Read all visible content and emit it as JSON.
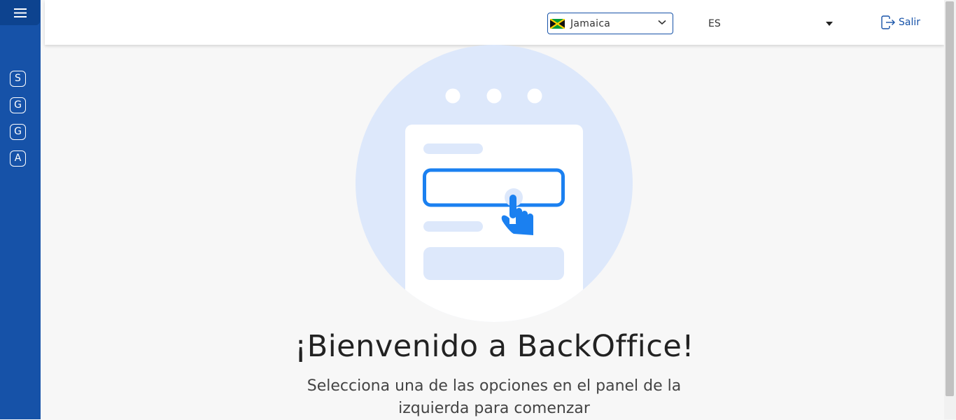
{
  "sidebar": {
    "items": [
      {
        "label": "S"
      },
      {
        "label": "G"
      },
      {
        "label": "G"
      },
      {
        "label": "A"
      }
    ]
  },
  "header": {
    "country_select": {
      "value": "Jamaica",
      "flag_icon": "jamaica-flag-icon"
    },
    "language_select": {
      "value": "ES"
    },
    "logout_label": "Salir"
  },
  "main": {
    "title": "¡Bienvenido a BackOffice!",
    "subtitle": "Selecciona una de las opciones en el panel de la izquierda para comenzar"
  },
  "colors": {
    "sidebar": "#1652a8",
    "accent": "#1b80f0",
    "background": "#f7f7f7"
  }
}
